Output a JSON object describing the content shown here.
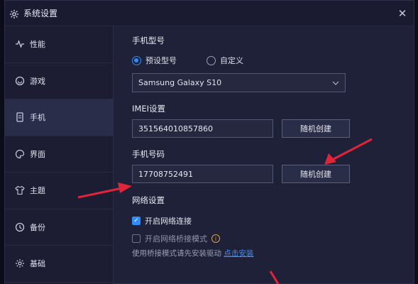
{
  "window": {
    "title": "系统设置"
  },
  "sidebar": {
    "items": [
      {
        "label": "性能",
        "icon": "pulse-icon"
      },
      {
        "label": "游戏",
        "icon": "gamepad-icon"
      },
      {
        "label": "手机",
        "icon": "phone-icon",
        "active": true
      },
      {
        "label": "界面",
        "icon": "palette-icon"
      },
      {
        "label": "主题",
        "icon": "shirt-icon"
      },
      {
        "label": "备份",
        "icon": "backup-icon"
      },
      {
        "label": "基础",
        "icon": "settings-icon"
      }
    ]
  },
  "phone_model": {
    "title": "手机型号",
    "preset_label": "预设型号",
    "custom_label": "自定义",
    "selected": "preset",
    "select_value": "Samsung Galaxy S10"
  },
  "imei": {
    "title": "IMEI设置",
    "value": "351564010857860",
    "button": "随机创建"
  },
  "phone_number": {
    "title": "手机号码",
    "value": "17708752491",
    "button": "随机创建"
  },
  "network": {
    "title": "网络设置",
    "enable_label": "开启网络连接",
    "enable_checked": true,
    "bridge_label": "开启网络桥接模式",
    "bridge_checked": false,
    "hint_text": "使用桥接模式请先安装驱动",
    "hint_link": "点击安装"
  },
  "colors": {
    "accent": "#2f8cff",
    "arrow": "#e0243a",
    "background": "#1f2138"
  }
}
